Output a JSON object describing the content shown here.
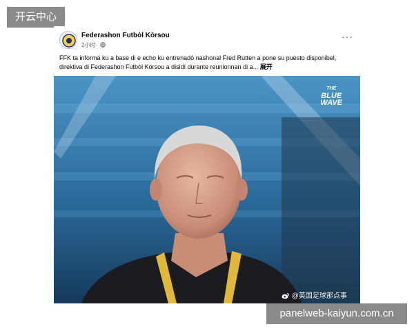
{
  "watermark_top": "开云中心",
  "watermark_bottom": "panelweb-kaiyun.com.cn",
  "post": {
    "page_name": "Federashon Futbòl Kòrsou",
    "time": "2小时",
    "more_label": "···",
    "text": "FFK ta informá ku a base di e echo ku entrenadó nashonal Fred Rutten a pone su puesto disponibel, direktiva di Federashon Futbòl Kòrsou a disidí durante reunionnan di a...",
    "expand_label": "展开",
    "photo_logo": {
      "line1": "THE",
      "line2": "BLUE",
      "line3": "WAVE"
    },
    "photo_watermark": "@英国足球那点事"
  },
  "icons": {
    "avatar": "ffk-crest-icon",
    "audience": "globe-icon",
    "more": "more-dots-icon",
    "weibo": "weibo-icon"
  }
}
